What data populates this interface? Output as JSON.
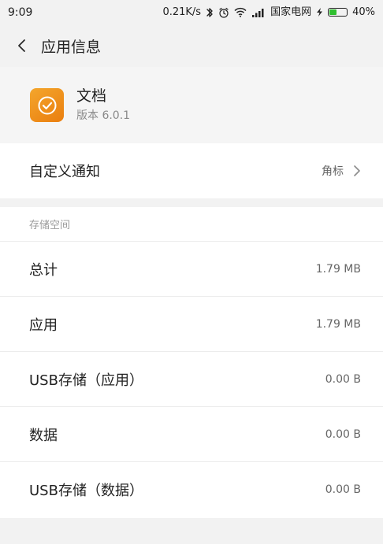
{
  "status_bar": {
    "time": "9:09",
    "speed": "0.21K/s",
    "carrier": "国家电网",
    "battery": "40%",
    "battery_level_percent": 40,
    "icons": {
      "bluetooth": "bluetooth-icon",
      "alarm": "alarm-icon",
      "wifi": "wifi-icon",
      "signal": "signal-icon",
      "charging": "charging-icon",
      "battery": "battery-icon"
    }
  },
  "header": {
    "title": "应用信息",
    "back_icon": "chevron-left-icon"
  },
  "app": {
    "name": "文档",
    "version": "版本 6.0.1",
    "icon": "check-circle-icon",
    "icon_colors": [
      "#f4a62c",
      "#ea7e0f"
    ]
  },
  "notification": {
    "label": "自定义通知",
    "value": "角标",
    "chevron_icon": "chevron-right-icon"
  },
  "storage": {
    "section_title": "存储空间",
    "rows": [
      {
        "label": "总计",
        "value": "1.79 MB"
      },
      {
        "label": "应用",
        "value": "1.79 MB"
      },
      {
        "label": "USB存储（应用）",
        "value": "0.00 B"
      },
      {
        "label": "数据",
        "value": "0.00 B"
      },
      {
        "label": "USB存储（数据）",
        "value": "0.00 B"
      }
    ]
  },
  "colors": {
    "accent_orange": "#f08b1c",
    "battery_green": "#2fbf2f",
    "background": "#f2f2f2"
  }
}
